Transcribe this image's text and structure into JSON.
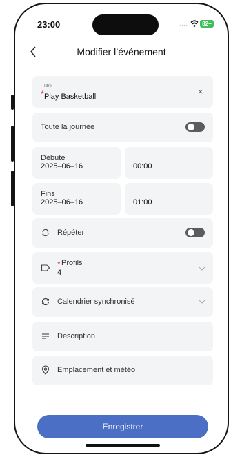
{
  "status_bar": {
    "time": "23:00",
    "signal": "....",
    "battery": "82+"
  },
  "header": {
    "title": "Modifier l’événement"
  },
  "form": {
    "title_field": {
      "label": "Titre",
      "required_mark": "*",
      "value": "Play Basketball",
      "clear_symbol": "×"
    },
    "all_day": {
      "label": "Toute la journée",
      "enabled": false
    },
    "start": {
      "label": "Débute",
      "date": "2025–06–16",
      "time": "00:00"
    },
    "end": {
      "label": "Fins",
      "date": "2025–06–16",
      "time": "01:00"
    },
    "repeat": {
      "label": "Répéter",
      "enabled": false
    },
    "profiles": {
      "required_mark": "*",
      "label": "Profils",
      "value": "4"
    },
    "calendar_sync": {
      "label": "Calendrier synchronisé"
    },
    "description": {
      "label": "Description"
    },
    "location": {
      "label": "Emplacement et météo"
    }
  },
  "actions": {
    "save_label": "Enregistrer"
  },
  "colors": {
    "accent": "#4a6fc4",
    "required": "#e53935",
    "field_bg": "#f3f4f6",
    "toggle_off": "#5c5c5c"
  },
  "icons": {
    "back": "chevron-left-icon",
    "repeat": "repeat-icon",
    "profiles": "tag-icon",
    "sync": "sync-icon",
    "description": "text-lines-icon",
    "location": "location-pin-icon"
  }
}
